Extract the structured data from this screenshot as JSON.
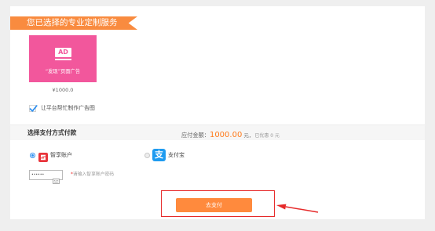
{
  "service_section": {
    "title": "您已选择的专业定制服务",
    "card": {
      "icon": "ad-icon",
      "icon_text": "AD",
      "name": "“发现”页面广告",
      "price": "¥1000.0"
    },
    "design_help": {
      "label": "让平台帮忙制作广告图",
      "checked": true
    }
  },
  "payment": {
    "title": "选择支付方式付款",
    "amount_label": "应付金额：",
    "amount_value": "1000.00",
    "amount_unit": "元，",
    "discount_text": "已优惠 0 元",
    "methods": [
      {
        "label": "智享账户",
        "selected": true,
        "icon": "zhixiang-logo-icon"
      },
      {
        "label": "支付宝",
        "selected": false,
        "icon": "alipay-icon",
        "icon_text": "支"
      }
    ],
    "password": {
      "masked_value": "••••••",
      "keyboard_icon": "keyboard-icon",
      "required_mark": "*",
      "hint": "请输入智享账户密码"
    },
    "submit_label": "去支付"
  },
  "colors": {
    "page_background": "#efefef",
    "banner_orange": "#f98b3f",
    "card_pink": "#f2579c",
    "amount_orange": "#ff7b1c",
    "button_orange": "#ff8a3d",
    "selected_blue": "#2b8ef0",
    "alipay_blue": "#1e9bf0",
    "zhixiang_red": "#e8343b",
    "annotation_red": "#e62a2a"
  }
}
